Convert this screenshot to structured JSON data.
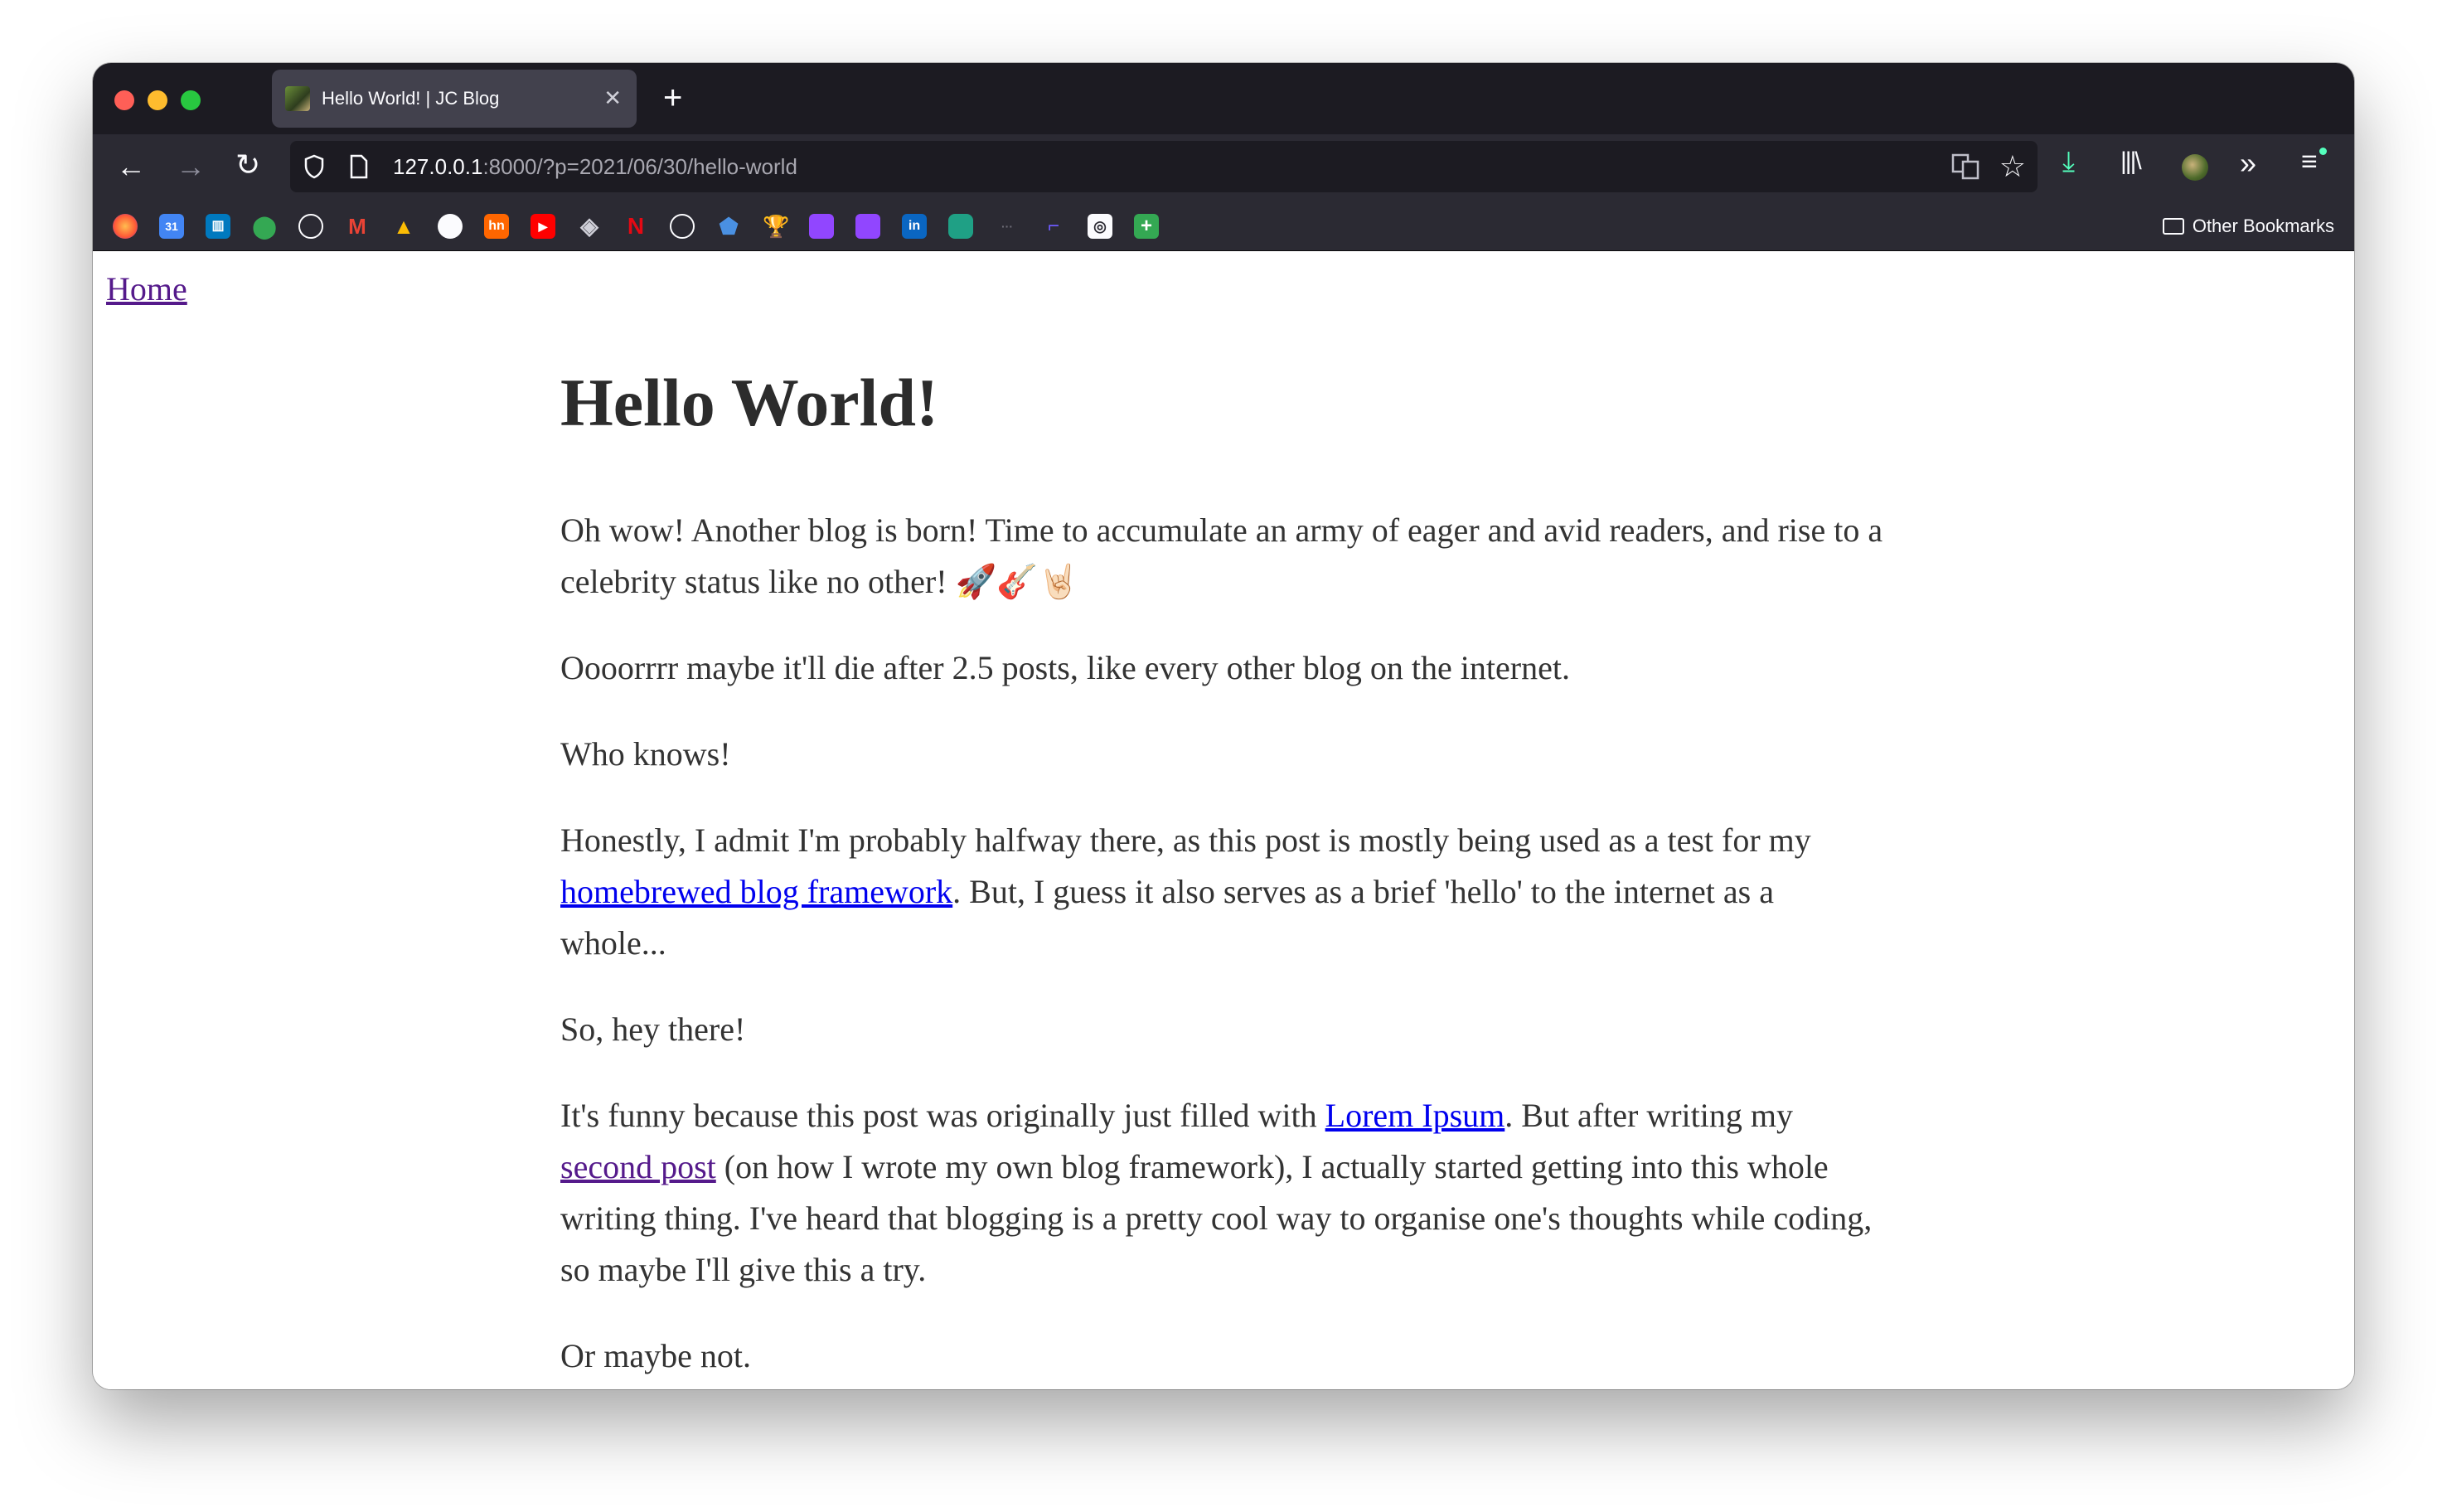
{
  "browser": {
    "tab": {
      "title": "Hello World! | JC Blog"
    },
    "url": {
      "host": "127.0.0.1",
      "path": ":8000/?p=2021/06/30/hello-world"
    },
    "bookmarks_other_label": "Other Bookmarks",
    "bookmark_icons": [
      "firefox-icon",
      "calendar-icon",
      "trello-icon",
      "maps-icon",
      "globe-icon",
      "gmail-icon",
      "drive-icon",
      "github-icon",
      "hn-icon",
      "youtube-icon",
      "layers-icon",
      "netflix-icon",
      "globe-icon",
      "shield-icon",
      "trophy-icon",
      "twitch-icon",
      "twitch-icon",
      "linkedin-icon",
      "pocket-icon",
      "dots-icon",
      "bracket-icon",
      "circle-icon",
      "plus-icon"
    ],
    "bookmark_labels": {
      "calendar": "31",
      "hn": "hn",
      "netflix": "N",
      "linkedin": "in"
    }
  },
  "page": {
    "home_link": "Home",
    "title": "Hello World!",
    "p1": "Oh wow! Another blog is born! Time to accumulate an army of eager and avid readers, and rise to a celebrity status like no other! 🚀🎸🤘🏻",
    "p2": "Oooorrrr maybe it'll die after 2.5 posts, like every other blog on the internet.",
    "p3": "Who knows!",
    "p4_before": "Honestly, I admit I'm probably halfway there, as this post is mostly being used as a test for my ",
    "p4_link": "homebrewed blog framework",
    "p4_after": ". But, I guess it also serves as a brief 'hello' to the internet as a whole...",
    "p5": "So, hey there!",
    "p6_before": "It's funny because this post was originally just filled with ",
    "p6_link1": "Lorem Ipsum",
    "p6_mid": ". But after writing my ",
    "p6_link2": "second post",
    "p6_after": " (on how I wrote my own blog framework), I actually started getting into this whole writing thing. I've heard that blogging is a pretty cool way to organise one's thoughts while coding, so maybe I'll give this a try.",
    "p7": "Or maybe not."
  }
}
